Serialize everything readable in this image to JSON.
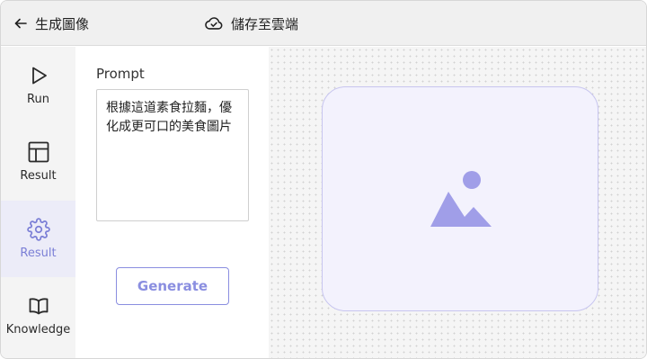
{
  "header": {
    "back_label": "生成圖像",
    "save_label": "儲存至雲端"
  },
  "sidebar": {
    "items": [
      {
        "label": "Run",
        "icon": "play-icon"
      },
      {
        "label": "Result",
        "icon": "table-icon"
      },
      {
        "label": "Result",
        "icon": "gear-icon",
        "active": true
      },
      {
        "label": "Knowledge",
        "icon": "book-icon"
      }
    ]
  },
  "prompt": {
    "title": "Prompt",
    "value": "根據這道素食拉麵，優化成更可口的美食圖片"
  },
  "generate": {
    "label": "Generate"
  },
  "canvas": {
    "placeholder_icon": "image-placeholder-icon"
  },
  "colors": {
    "accent": "#8a8ee0",
    "accent_dark": "#7b7fd6",
    "card_bg": "#f3f2fd"
  }
}
